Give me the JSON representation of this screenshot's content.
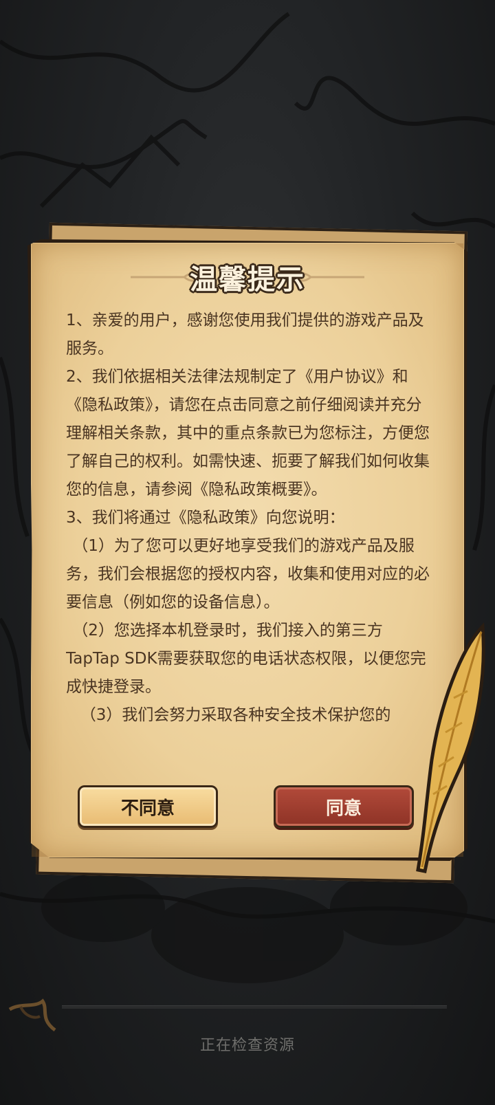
{
  "dialog": {
    "title": "温馨提示",
    "paragraphs": [
      "1、亲爱的用户，感谢您使用我们提供的游戏产品及服务。",
      "2、我们依据相关法律法规制定了《用户协议》和《隐私政策》，请您在点击同意之前仔细阅读并充分理解相关条款，其中的重点条款已为您标注，方便您了解自己的权利。如需快速、扼要了解我们如何收集您的信息，请参阅《隐私政策概要》。",
      "3、我们将通过《隐私政策》向您说明：",
      "（1）为了您可以更好地享受我们的游戏产品及服务，我们会根据您的授权内容，收集和使用对应的必要信息（例如您的设备信息）。",
      "（2）您选择本机登录时，我们接入的第三方TapTap SDK需要获取您的电话状态权限，以便您完成快捷登录。",
      "（3）我们会努力采取各种安全技术保护您的"
    ],
    "disagree_label": "不同意",
    "agree_label": "同意"
  },
  "loading": {
    "status_text": "正在检查资源"
  },
  "colors": {
    "parchment": "#ecd09a",
    "text_brown": "#4a3522",
    "agree_red": "#9e3a2d",
    "disagree_tan": "#f0cc8a",
    "background": "#1a1b1c"
  },
  "icons": {
    "feather": "quill-feather-icon",
    "title_ornament": "scroll-ornament-icon"
  }
}
